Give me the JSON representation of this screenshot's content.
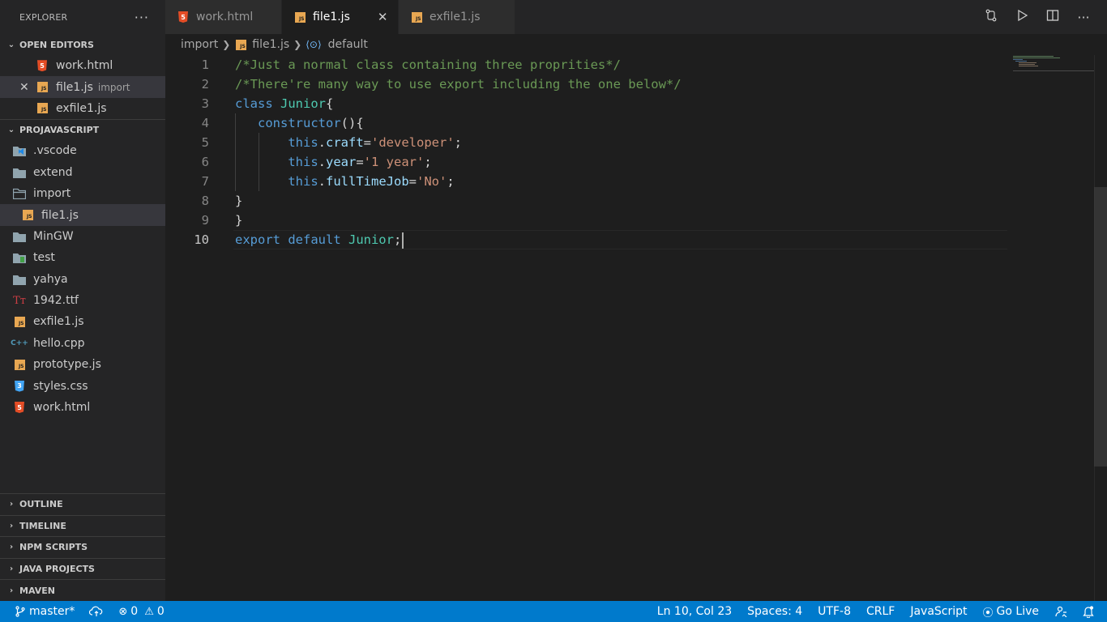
{
  "explorer": {
    "title": "EXPLORER",
    "more": "···",
    "open_editors": {
      "label": "OPEN EDITORS",
      "items": [
        {
          "name": "work.html",
          "icon": "html-icon"
        },
        {
          "name": "file1.js",
          "sub": "import",
          "icon": "js-icon",
          "close": "✕"
        },
        {
          "name": "exfile1.js",
          "icon": "js-icon"
        }
      ]
    },
    "project": {
      "label": "PROJAVASCRIPT",
      "items": [
        {
          "name": ".vscode",
          "icon": "vscode-folder-icon"
        },
        {
          "name": "extend",
          "icon": "folder-icon"
        },
        {
          "name": "import",
          "icon": "folder-open-icon"
        },
        {
          "name": "file1.js",
          "icon": "js-icon"
        },
        {
          "name": "MinGW",
          "icon": "folder-icon"
        },
        {
          "name": "test",
          "icon": "test-folder-icon"
        },
        {
          "name": "yahya",
          "icon": "folder-icon"
        },
        {
          "name": "1942.ttf",
          "icon": "font-icon"
        },
        {
          "name": "exfile1.js",
          "icon": "js-icon"
        },
        {
          "name": "hello.cpp",
          "icon": "cpp-icon"
        },
        {
          "name": "prototype.js",
          "icon": "js-icon"
        },
        {
          "name": "styles.css",
          "icon": "css-icon"
        },
        {
          "name": "work.html",
          "icon": "html-icon"
        }
      ]
    },
    "bottom_sections": [
      "OUTLINE",
      "TIMELINE",
      "NPM SCRIPTS",
      "JAVA PROJECTS",
      "MAVEN"
    ]
  },
  "tabs": [
    {
      "label": "work.html",
      "icon": "html-icon"
    },
    {
      "label": "file1.js",
      "icon": "js-icon",
      "close": "✕"
    },
    {
      "label": "exfile1.js",
      "icon": "js-icon"
    }
  ],
  "breadcrumb": {
    "folder": "import",
    "file": "file1.js",
    "symbol": "default"
  },
  "editor": {
    "line_numbers": [
      "1",
      "2",
      "3",
      "4",
      "5",
      "6",
      "7",
      "8",
      "9",
      "10"
    ],
    "lines": [
      [
        {
          "t": "/*Just a normal class containing three proprities*/",
          "c": "c-com"
        }
      ],
      [
        {
          "t": "/*There're many way to use export including the one below*/",
          "c": "c-com"
        }
      ],
      [
        {
          "t": "class ",
          "c": "c-kw"
        },
        {
          "t": "Junior",
          "c": "c-cls"
        },
        {
          "t": "{",
          "c": ""
        }
      ],
      [
        {
          "t": "   ",
          "c": ""
        },
        {
          "t": "constructor",
          "c": "c-kw"
        },
        {
          "t": "(){",
          "c": ""
        }
      ],
      [
        {
          "t": "       ",
          "c": ""
        },
        {
          "t": "this",
          "c": "c-kw"
        },
        {
          "t": ".",
          "c": ""
        },
        {
          "t": "craft",
          "c": "c-prop"
        },
        {
          "t": "=",
          "c": ""
        },
        {
          "t": "'developer'",
          "c": "c-str"
        },
        {
          "t": ";",
          "c": ""
        }
      ],
      [
        {
          "t": "       ",
          "c": ""
        },
        {
          "t": "this",
          "c": "c-kw"
        },
        {
          "t": ".",
          "c": ""
        },
        {
          "t": "year",
          "c": "c-prop"
        },
        {
          "t": "=",
          "c": ""
        },
        {
          "t": "'1 year'",
          "c": "c-str"
        },
        {
          "t": ";",
          "c": ""
        }
      ],
      [
        {
          "t": "       ",
          "c": ""
        },
        {
          "t": "this",
          "c": "c-kw"
        },
        {
          "t": ".",
          "c": ""
        },
        {
          "t": "fullTimeJob",
          "c": "c-prop"
        },
        {
          "t": "=",
          "c": ""
        },
        {
          "t": "'No'",
          "c": "c-str"
        },
        {
          "t": ";",
          "c": ""
        }
      ],
      [
        {
          "t": "}",
          "c": ""
        }
      ],
      [
        {
          "t": "}",
          "c": ""
        }
      ],
      [
        {
          "t": "export ",
          "c": "c-kw"
        },
        {
          "t": "default ",
          "c": "c-kw"
        },
        {
          "t": "Junior",
          "c": "c-cls"
        },
        {
          "t": ";",
          "c": ""
        }
      ]
    ]
  },
  "statusbar": {
    "branch": "master*",
    "errors": "0",
    "warnings": "0",
    "position": "Ln 10, Col 23",
    "spaces": "Spaces: 4",
    "encoding": "UTF-8",
    "eol": "CRLF",
    "language": "JavaScript",
    "golive": "Go Live"
  },
  "colors": {
    "accent": "#007acc",
    "sidebar": "#252526",
    "editor": "#1e1e1e"
  }
}
